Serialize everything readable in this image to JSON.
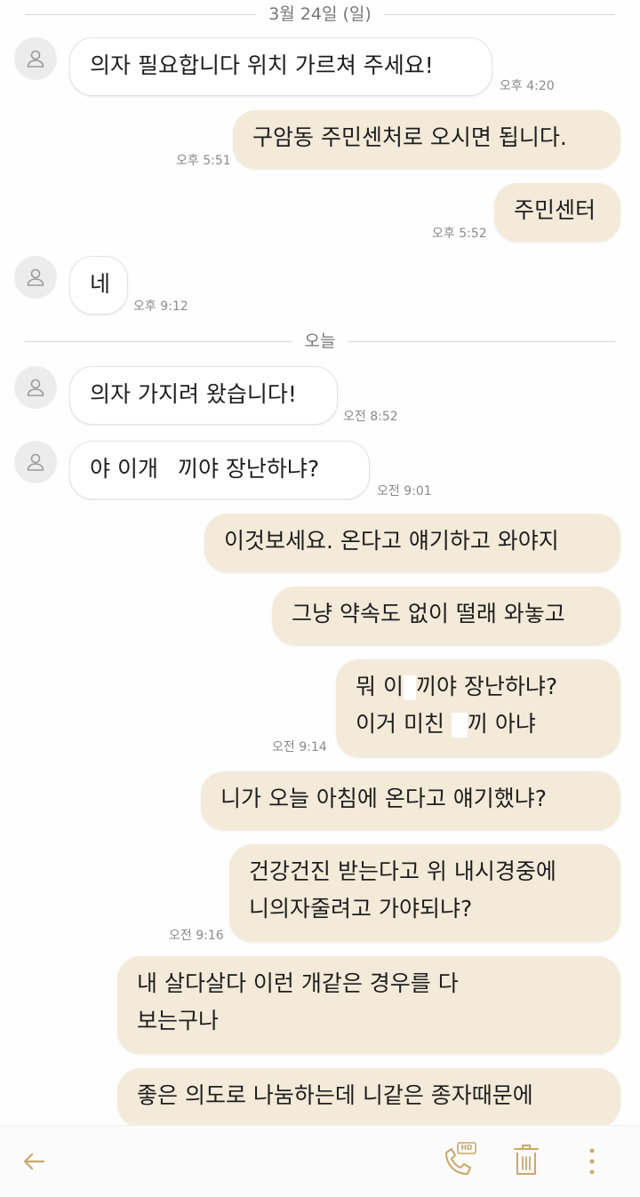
{
  "dates": {
    "first": "3월 24일 (일)",
    "today": "오늘"
  },
  "messages": [
    {
      "dir": "in",
      "text": "의자 필요합니다 위치 가르쳐 주세요!",
      "time": "오후 4:20"
    },
    {
      "dir": "out",
      "text": "구암동 주민센처로 오시면 됩니다.",
      "time": "오후 5:51"
    },
    {
      "dir": "out",
      "text": "주민센터",
      "time": "오후 5:52"
    },
    {
      "dir": "in",
      "text": "네",
      "time": "오후 9:12"
    },
    {
      "dir": "in",
      "text": "의자 가지려 왔습니다!",
      "time": "오전 8:52"
    },
    {
      "dir": "in",
      "text_a": "야 이개",
      "text_b": "끼야 장난하냐?",
      "time": "오전 9:01"
    },
    {
      "dir": "out",
      "text": "이것보세요. 온다고 얘기하고 와야지"
    },
    {
      "dir": "out",
      "text": "그냥 약속도 없이 떨래 와놓고"
    },
    {
      "dir": "out",
      "line1_a": "뭐 이",
      "line1_b": "끼야 장난하냐?",
      "line2_a": "이거 미친",
      "line2_b": "끼 아냐",
      "time": "오전 9:14"
    },
    {
      "dir": "out",
      "text": "니가 오늘 아침에 온다고 얘기했냐?"
    },
    {
      "dir": "out",
      "line1": "건강건진 받는다고 위 내시경중에",
      "line2": "니의자줄려고 가야되냐?",
      "time": "오전 9:16"
    },
    {
      "dir": "out",
      "line1": "내 살다살다 이런 개같은 경우를 다",
      "line2": "보는구나"
    },
    {
      "dir": "out",
      "text": "좋은 의도로 나눔하는데 니같은 종자때문에"
    }
  ],
  "toolbar": {
    "back_icon": "arrow-left-icon",
    "call_icon": "hd-call-icon",
    "call_badge": "HD",
    "delete_icon": "trash-icon",
    "more_icon": "more-vertical-icon"
  },
  "colors": {
    "outgoing_bubble": "#f4ead9",
    "incoming_bubble": "#ffffff",
    "accent": "#c9a86a"
  }
}
